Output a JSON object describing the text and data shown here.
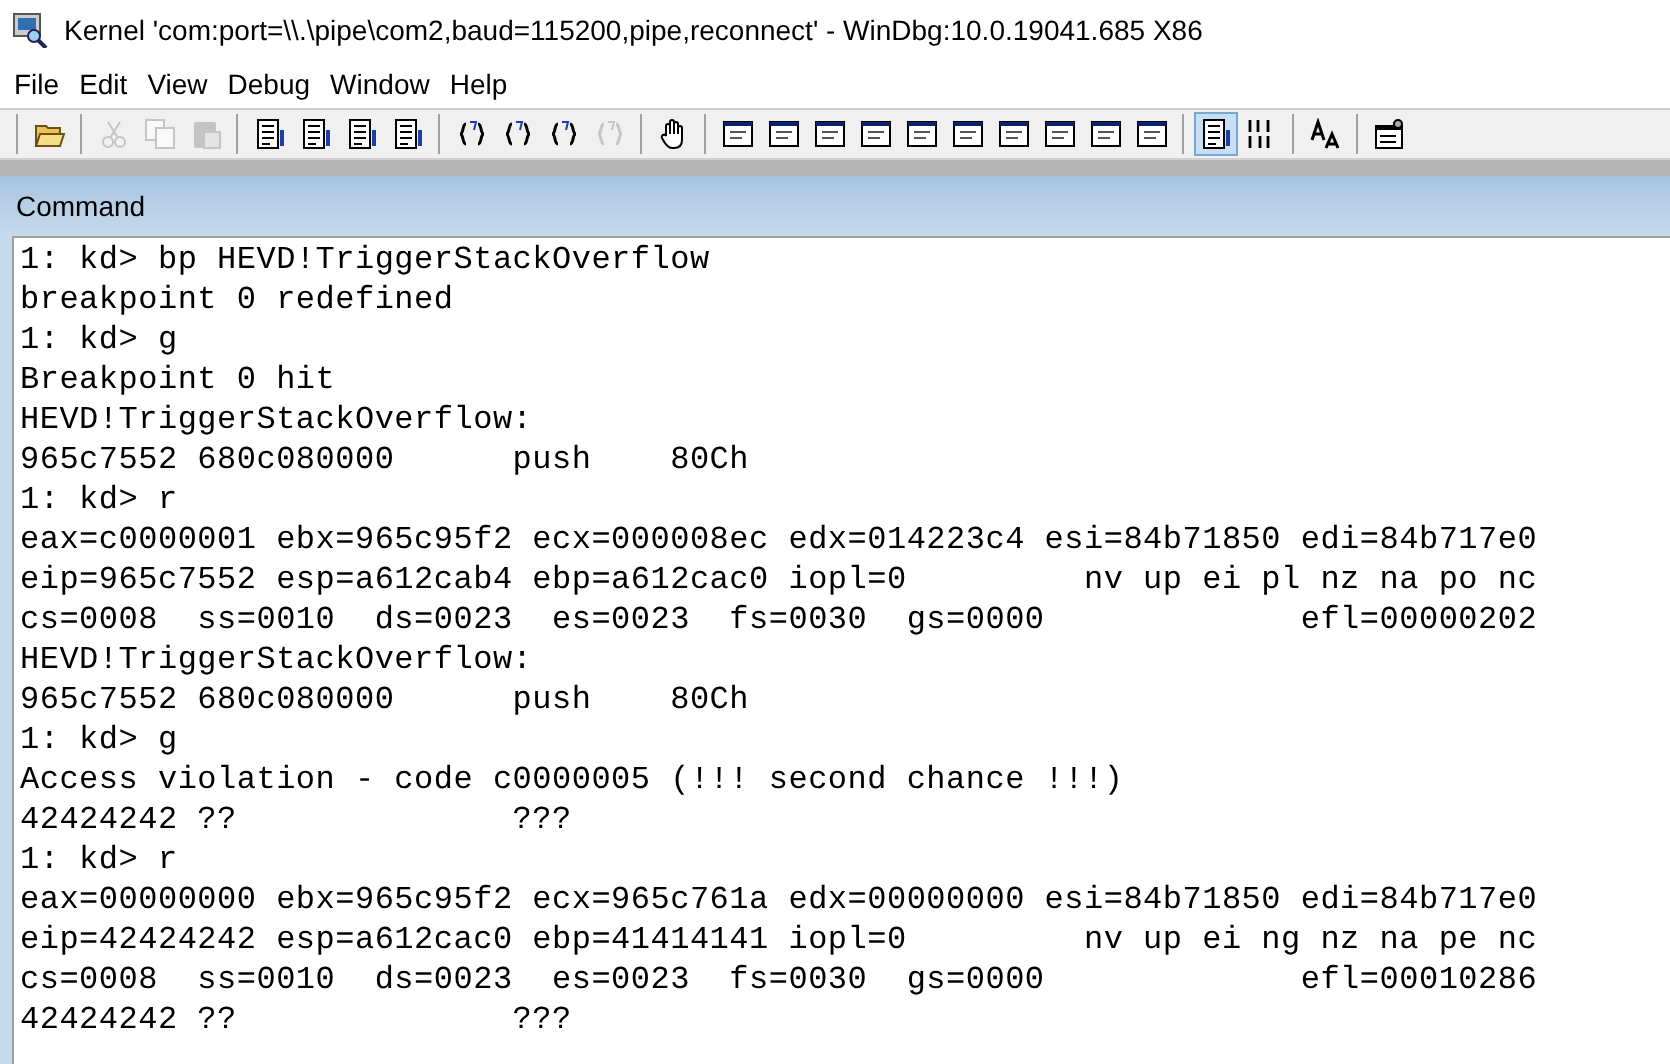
{
  "window": {
    "title": "Kernel 'com:port=\\\\.\\pipe\\com2,baud=115200,pipe,reconnect' - WinDbg:10.0.19041.685 X86"
  },
  "menu": [
    "File",
    "Edit",
    "View",
    "Debug",
    "Window",
    "Help"
  ],
  "toolbar": [
    [
      {
        "kind": "folder",
        "disabled": false,
        "selected": false
      }
    ],
    [
      {
        "kind": "scissors",
        "disabled": true,
        "selected": false
      },
      {
        "kind": "copy",
        "disabled": true,
        "selected": false
      },
      {
        "kind": "paste",
        "disabled": true,
        "selected": false
      }
    ],
    [
      {
        "kind": "document",
        "disabled": false,
        "selected": false
      },
      {
        "kind": "document",
        "disabled": false,
        "selected": false
      },
      {
        "kind": "document",
        "disabled": false,
        "selected": false
      },
      {
        "kind": "document",
        "disabled": false,
        "selected": false
      }
    ],
    [
      {
        "kind": "braces",
        "disabled": false,
        "selected": false
      },
      {
        "kind": "braces",
        "disabled": false,
        "selected": false
      },
      {
        "kind": "braces",
        "disabled": false,
        "selected": false
      },
      {
        "kind": "braces",
        "disabled": true,
        "selected": false
      }
    ],
    [
      {
        "kind": "hand",
        "disabled": false,
        "selected": false
      }
    ],
    [
      {
        "kind": "window",
        "disabled": false,
        "selected": false
      },
      {
        "kind": "window",
        "disabled": false,
        "selected": false
      },
      {
        "kind": "window",
        "disabled": false,
        "selected": false
      },
      {
        "kind": "window",
        "disabled": false,
        "selected": false
      },
      {
        "kind": "window",
        "disabled": false,
        "selected": false
      },
      {
        "kind": "window",
        "disabled": false,
        "selected": false
      },
      {
        "kind": "window",
        "disabled": false,
        "selected": false
      },
      {
        "kind": "window",
        "disabled": false,
        "selected": false
      },
      {
        "kind": "window",
        "disabled": false,
        "selected": false
      },
      {
        "kind": "window",
        "disabled": false,
        "selected": false
      }
    ],
    [
      {
        "kind": "document",
        "disabled": false,
        "selected": true
      },
      {
        "kind": "binary",
        "disabled": false,
        "selected": false
      }
    ],
    [
      {
        "kind": "font",
        "disabled": false,
        "selected": false
      }
    ],
    [
      {
        "kind": "options",
        "disabled": false,
        "selected": false
      }
    ]
  ],
  "panel": {
    "title": "Command"
  },
  "output": [
    "1: kd> bp HEVD!TriggerStackOverflow",
    "breakpoint 0 redefined",
    "1: kd> g",
    "Breakpoint 0 hit",
    "HEVD!TriggerStackOverflow:",
    "965c7552 680c080000      push    80Ch",
    "1: kd> r",
    "eax=c0000001 ebx=965c95f2 ecx=000008ec edx=014223c4 esi=84b71850 edi=84b717e0",
    "eip=965c7552 esp=a612cab4 ebp=a612cac0 iopl=0         nv up ei pl nz na po nc",
    "cs=0008  ss=0010  ds=0023  es=0023  fs=0030  gs=0000             efl=00000202",
    "HEVD!TriggerStackOverflow:",
    "965c7552 680c080000      push    80Ch",
    "1: kd> g",
    "Access violation - code c0000005 (!!! second chance !!!)",
    "42424242 ??              ???",
    "1: kd> r",
    "eax=00000000 ebx=965c95f2 ecx=965c761a edx=00000000 esi=84b71850 edi=84b717e0",
    "eip=42424242 esp=a612cac0 ebp=41414141 iopl=0         nv up ei ng nz na pe nc",
    "cs=0008  ss=0010  ds=0023  es=0023  fs=0030  gs=0000             efl=00010286",
    "42424242 ??              ???"
  ]
}
